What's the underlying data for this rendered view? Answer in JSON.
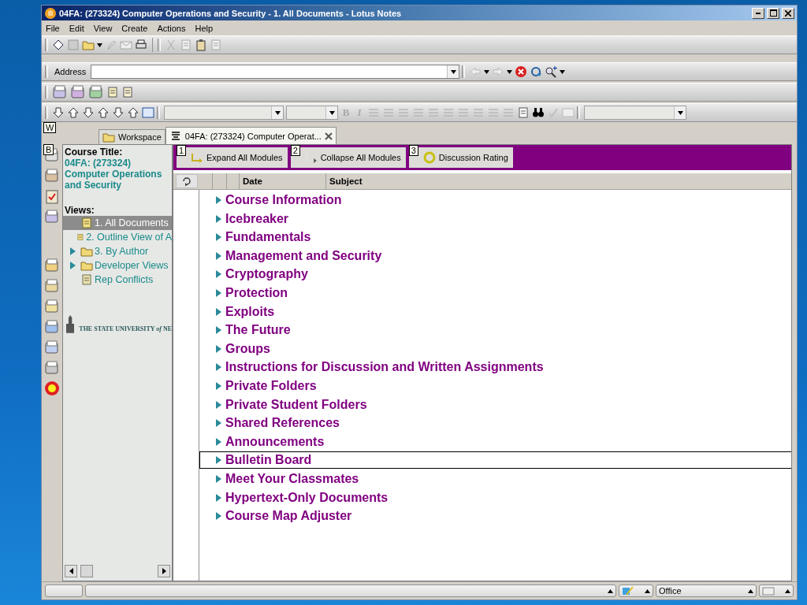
{
  "window": {
    "title": "04FA: (273324) Computer Operations and Security - 1. All Documents - Lotus Notes"
  },
  "menu": [
    "File",
    "Edit",
    "View",
    "Create",
    "Actions",
    "Help"
  ],
  "address": {
    "label": "Address"
  },
  "format_toolbar": {
    "bold": "B",
    "italic": "I"
  },
  "tab_hotkey": "W",
  "tabs": [
    {
      "label": "Workspace",
      "selected": false,
      "kind": "workspace"
    },
    {
      "label": "04FA: (273324) Computer Operat...",
      "selected": true,
      "kind": "database"
    }
  ],
  "bookmark_hotkey": "B",
  "nav": {
    "course_label": "Course Title:",
    "course_name": "04FA: (273324) Computer Operations and Security",
    "views_label": "Views:",
    "views": [
      {
        "label": "1. All Documents",
        "selected": true,
        "kind": "view"
      },
      {
        "label": "2. Outline View of A",
        "selected": false,
        "kind": "view"
      },
      {
        "label": "3.  By Author",
        "selected": false,
        "kind": "folder",
        "expanded": false
      },
      {
        "label": "Developer Views",
        "selected": false,
        "kind": "folder",
        "expanded": false
      },
      {
        "label": "Rep Conflicts",
        "selected": false,
        "kind": "conflict"
      }
    ],
    "logo_text": "THE STATE UNIVERSITY *of* NE"
  },
  "actions": [
    {
      "hotkey": "1",
      "label": "Expand All Modules",
      "kind": "expand"
    },
    {
      "hotkey": "2",
      "label": "Collapse All Modules",
      "kind": "collapse"
    },
    {
      "hotkey": "3",
      "label": "Discussion Rating",
      "kind": "rating"
    }
  ],
  "columns": [
    "Date",
    "Subject"
  ],
  "rows": [
    {
      "label": "Course Information",
      "selected": false,
      "expanded": false
    },
    {
      "label": "Icebreaker",
      "selected": false,
      "expanded": false
    },
    {
      "label": "Fundamentals",
      "selected": false,
      "expanded": false
    },
    {
      "label": "Management and Security",
      "selected": false,
      "expanded": false
    },
    {
      "label": "Cryptography",
      "selected": false,
      "expanded": false
    },
    {
      "label": "Protection",
      "selected": false,
      "expanded": false
    },
    {
      "label": "Exploits",
      "selected": false,
      "expanded": false
    },
    {
      "label": "The Future",
      "selected": false,
      "expanded": false
    },
    {
      "label": "Groups",
      "selected": false,
      "expanded": false
    },
    {
      "label": "Instructions for Discussion and Written Assignments",
      "selected": false,
      "expanded": false
    },
    {
      "label": "Private Folders",
      "selected": false,
      "expanded": false
    },
    {
      "label": "Private Student Folders",
      "selected": false,
      "expanded": false
    },
    {
      "label": "Shared References",
      "selected": false,
      "expanded": false
    },
    {
      "label": "Announcements",
      "selected": false,
      "expanded": false
    },
    {
      "label": "Bulletin Board",
      "selected": true,
      "expanded": false
    },
    {
      "label": "Meet Your Classmates",
      "selected": false,
      "expanded": false
    },
    {
      "label": "Hypertext-Only Documents",
      "selected": false,
      "expanded": false
    },
    {
      "label": "Course Map Adjuster",
      "selected": false,
      "expanded": false
    }
  ],
  "status_bar": {
    "location": "Office"
  }
}
